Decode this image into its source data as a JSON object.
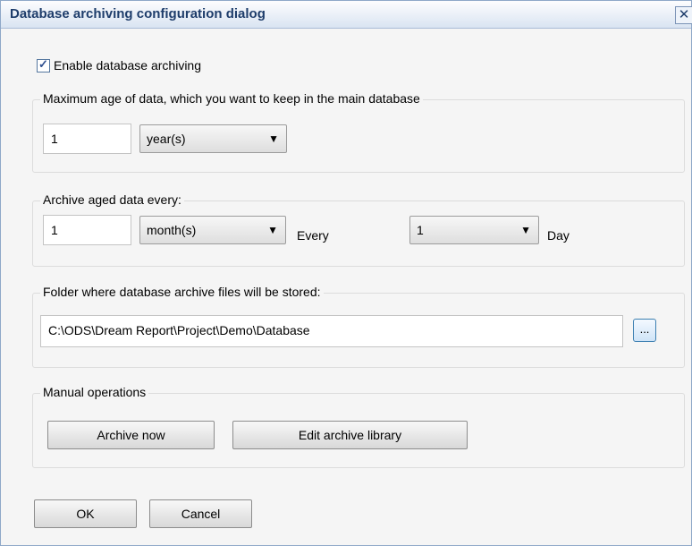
{
  "window": {
    "title": "Database archiving configuration dialog",
    "close_glyph": "✕"
  },
  "enable_archiving": {
    "checked": true,
    "check_glyph": "✓",
    "label": "Enable database archiving"
  },
  "max_age": {
    "legend": "Maximum age of data, which you want to keep in the main database",
    "value": "1",
    "unit": "year(s)"
  },
  "archive_every": {
    "legend": "Archive aged data every:",
    "value": "1",
    "unit": "month(s)",
    "every_label": "Every",
    "day_value": "1",
    "day_label": "Day"
  },
  "folder": {
    "legend": "Folder where database archive files will be stored:",
    "path": "C:\\ODS\\Dream Report\\Project\\Demo\\Database",
    "browse_label": "..."
  },
  "manual": {
    "legend": "Manual operations",
    "archive_now_label": "Archive now",
    "edit_library_label": "Edit archive library"
  },
  "footer": {
    "ok_label": "OK",
    "cancel_label": "Cancel"
  },
  "icons": {
    "dropdown_arrow": "▼"
  }
}
